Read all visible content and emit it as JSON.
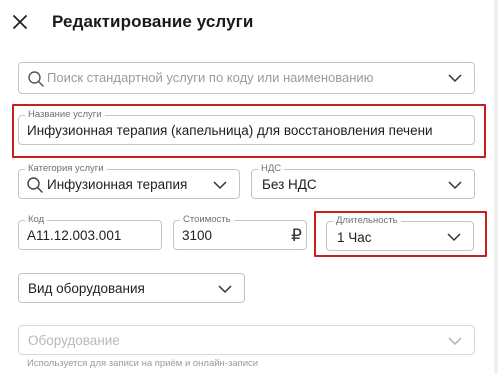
{
  "header": {
    "title": "Редактирование услуги",
    "close_icon": "close-icon"
  },
  "search": {
    "placeholder": "Поиск стандартной услуги по коду или наименованию"
  },
  "service_name": {
    "label": "Название услуги",
    "value": "Инфузионная терапия (капельница) для восстановления печени"
  },
  "category": {
    "label": "Категория услуги",
    "value": "Инфузионная терапия"
  },
  "vat": {
    "label": "НДС",
    "value": "Без НДС"
  },
  "code": {
    "label": "Код",
    "value": "A11.12.003.001"
  },
  "price": {
    "label": "Стоимость",
    "value": "3100",
    "currency": "₽"
  },
  "duration": {
    "label": "Длительность",
    "value": "1 Час"
  },
  "equipment_type": {
    "value": "Вид оборудования"
  },
  "equipment": {
    "placeholder": "Оборудование",
    "helper": "Используется для записи на приём и онлайн-записи"
  },
  "colors": {
    "highlight": "#c81e1e",
    "border": "#c4c4c4"
  }
}
